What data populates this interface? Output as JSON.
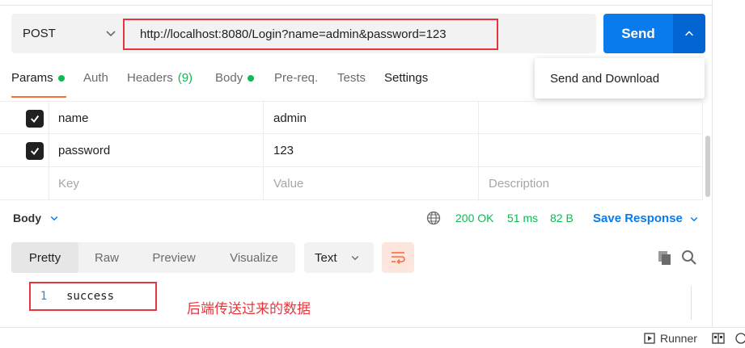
{
  "request": {
    "method": "POST",
    "url": "http://localhost:8080/Login?name=admin&password=123",
    "send_label": "Send",
    "send_menu_item": "Send and Download"
  },
  "tabs": [
    {
      "label": "Params",
      "dot": true,
      "active": true
    },
    {
      "label": "Auth"
    },
    {
      "label": "Headers",
      "count": "(9)"
    },
    {
      "label": "Body",
      "dot": true
    },
    {
      "label": "Pre-req."
    },
    {
      "label": "Tests"
    },
    {
      "label": "Settings"
    }
  ],
  "params": {
    "rows": [
      {
        "checked": true,
        "key": "name",
        "value": "admin",
        "description": ""
      },
      {
        "checked": true,
        "key": "password",
        "value": "123",
        "description": ""
      }
    ],
    "placeholder": {
      "key": "Key",
      "value": "Value",
      "description": "Description"
    }
  },
  "response": {
    "label": "Body",
    "status": "200 OK",
    "time": "51 ms",
    "size": "82 B",
    "save_label": "Save Response",
    "views": [
      "Pretty",
      "Raw",
      "Preview",
      "Visualize"
    ],
    "active_view": "Pretty",
    "format": "Text",
    "lines": [
      {
        "number": "1",
        "text": "success"
      }
    ],
    "annotation": "后端传送过来的数据"
  },
  "footer": {
    "runner_label": "Runner"
  },
  "colors": {
    "send": "#097bed",
    "status_ok": "#0cbb52",
    "highlight": "#e8353c",
    "accent": "#ff6c37"
  }
}
